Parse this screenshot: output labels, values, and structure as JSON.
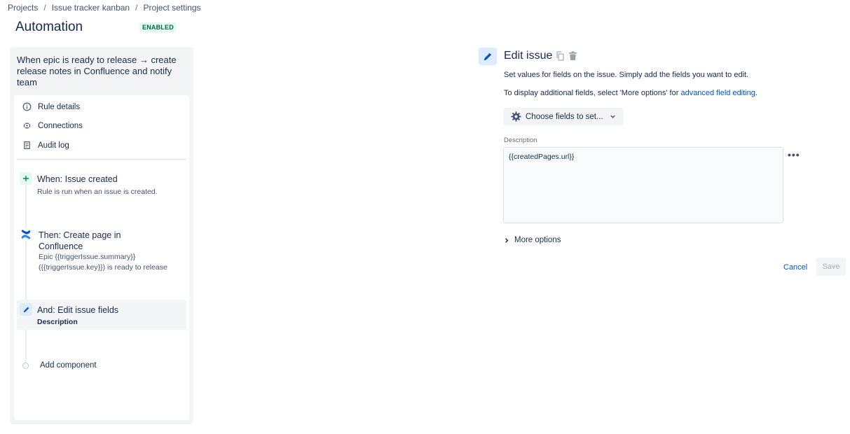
{
  "breadcrumb": [
    "Projects",
    "Issue tracker kanban",
    "Project settings"
  ],
  "page": {
    "title": "Automation",
    "status_badge": "ENABLED"
  },
  "rule": {
    "name": "When epic is ready to release → create release notes in Confluence and notify team",
    "nav": [
      {
        "label": "Rule details",
        "icon": "info-icon"
      },
      {
        "label": "Connections",
        "icon": "connections-icon"
      },
      {
        "label": "Audit log",
        "icon": "audit-log-icon"
      }
    ],
    "components": {
      "trigger": {
        "title": "When: Issue created",
        "sub": "Rule is run when an issue is created."
      },
      "action1": {
        "title_l1": "Then: Create page in",
        "title_l2": "Confluence",
        "sub_l1": "Epic {{triggerIssue.summary}}",
        "sub_l2": "({{triggerIssue.key}}) is ready to release"
      },
      "action2": {
        "title": "And: Edit issue fields",
        "sub": "Description"
      }
    },
    "add_component": "Add component"
  },
  "editor": {
    "title": "Edit issue",
    "desc1": "Set values for fields on the issue. Simply add the fields you want to edit.",
    "desc2_prefix": "To display additional fields, select 'More options' for ",
    "desc2_link": "advanced field editing",
    "desc2_suffix": ".",
    "choose_fields": "Choose fields to set...",
    "description_label": "Description",
    "description_value": "{{createdPages.url}}",
    "more_options": "More options",
    "cancel": "Cancel",
    "save": "Save"
  },
  "colors": {
    "accent": "#0052cc",
    "badge_bg": "#e3fcef",
    "badge_text": "#006644",
    "panel_bg": "#f4f5f7"
  }
}
